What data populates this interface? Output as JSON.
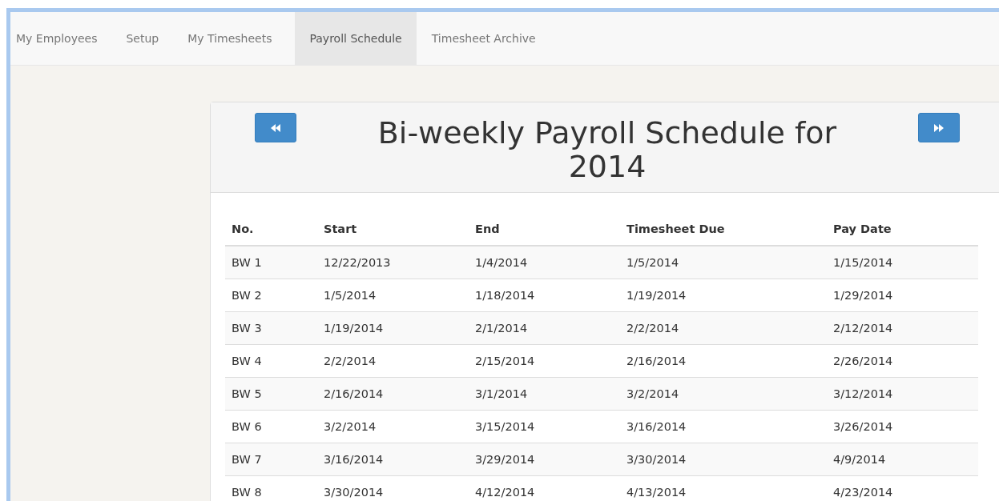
{
  "nav": {
    "tabs": [
      {
        "label": "My Employees",
        "selected": false
      },
      {
        "label": "Setup",
        "selected": false
      },
      {
        "label": "My Timesheets",
        "selected": false
      },
      {
        "label": "Payroll Schedule",
        "selected": true
      },
      {
        "label": "Timesheet Archive",
        "selected": false
      }
    ]
  },
  "panel": {
    "title": "Bi-weekly Payroll Schedule for 2014",
    "table": {
      "columns": [
        "No.",
        "Start",
        "End",
        "Timesheet Due",
        "Pay Date"
      ],
      "rows": [
        [
          "BW 1",
          "12/22/2013",
          "1/4/2014",
          "1/5/2014",
          "1/15/2014"
        ],
        [
          "BW 2",
          "1/5/2014",
          "1/18/2014",
          "1/19/2014",
          "1/29/2014"
        ],
        [
          "BW 3",
          "1/19/2014",
          "2/1/2014",
          "2/2/2014",
          "2/12/2014"
        ],
        [
          "BW 4",
          "2/2/2014",
          "2/15/2014",
          "2/16/2014",
          "2/26/2014"
        ],
        [
          "BW 5",
          "2/16/2014",
          "3/1/2014",
          "3/2/2014",
          "3/12/2014"
        ],
        [
          "BW 6",
          "3/2/2014",
          "3/15/2014",
          "3/16/2014",
          "3/26/2014"
        ],
        [
          "BW 7",
          "3/16/2014",
          "3/29/2014",
          "3/30/2014",
          "4/9/2014"
        ],
        [
          "BW 8",
          "3/30/2014",
          "4/12/2014",
          "4/13/2014",
          "4/23/2014"
        ]
      ]
    }
  }
}
